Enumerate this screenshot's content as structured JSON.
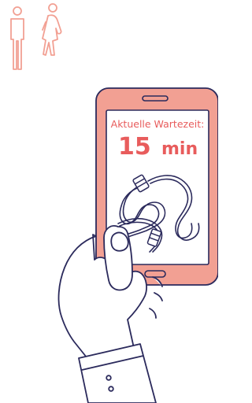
{
  "screen": {
    "wait_label": "Aktuelle Wartezeit:",
    "wait_value": "15",
    "wait_unit": "min"
  },
  "icons": {
    "toilet_sign": "restroom-icon",
    "phone": "smartphone-illustration"
  },
  "colors": {
    "accent": "#f2a093",
    "accent_dark": "#e85c5c",
    "outline": "#2b2a5c",
    "screen_text": "#ffffff"
  }
}
